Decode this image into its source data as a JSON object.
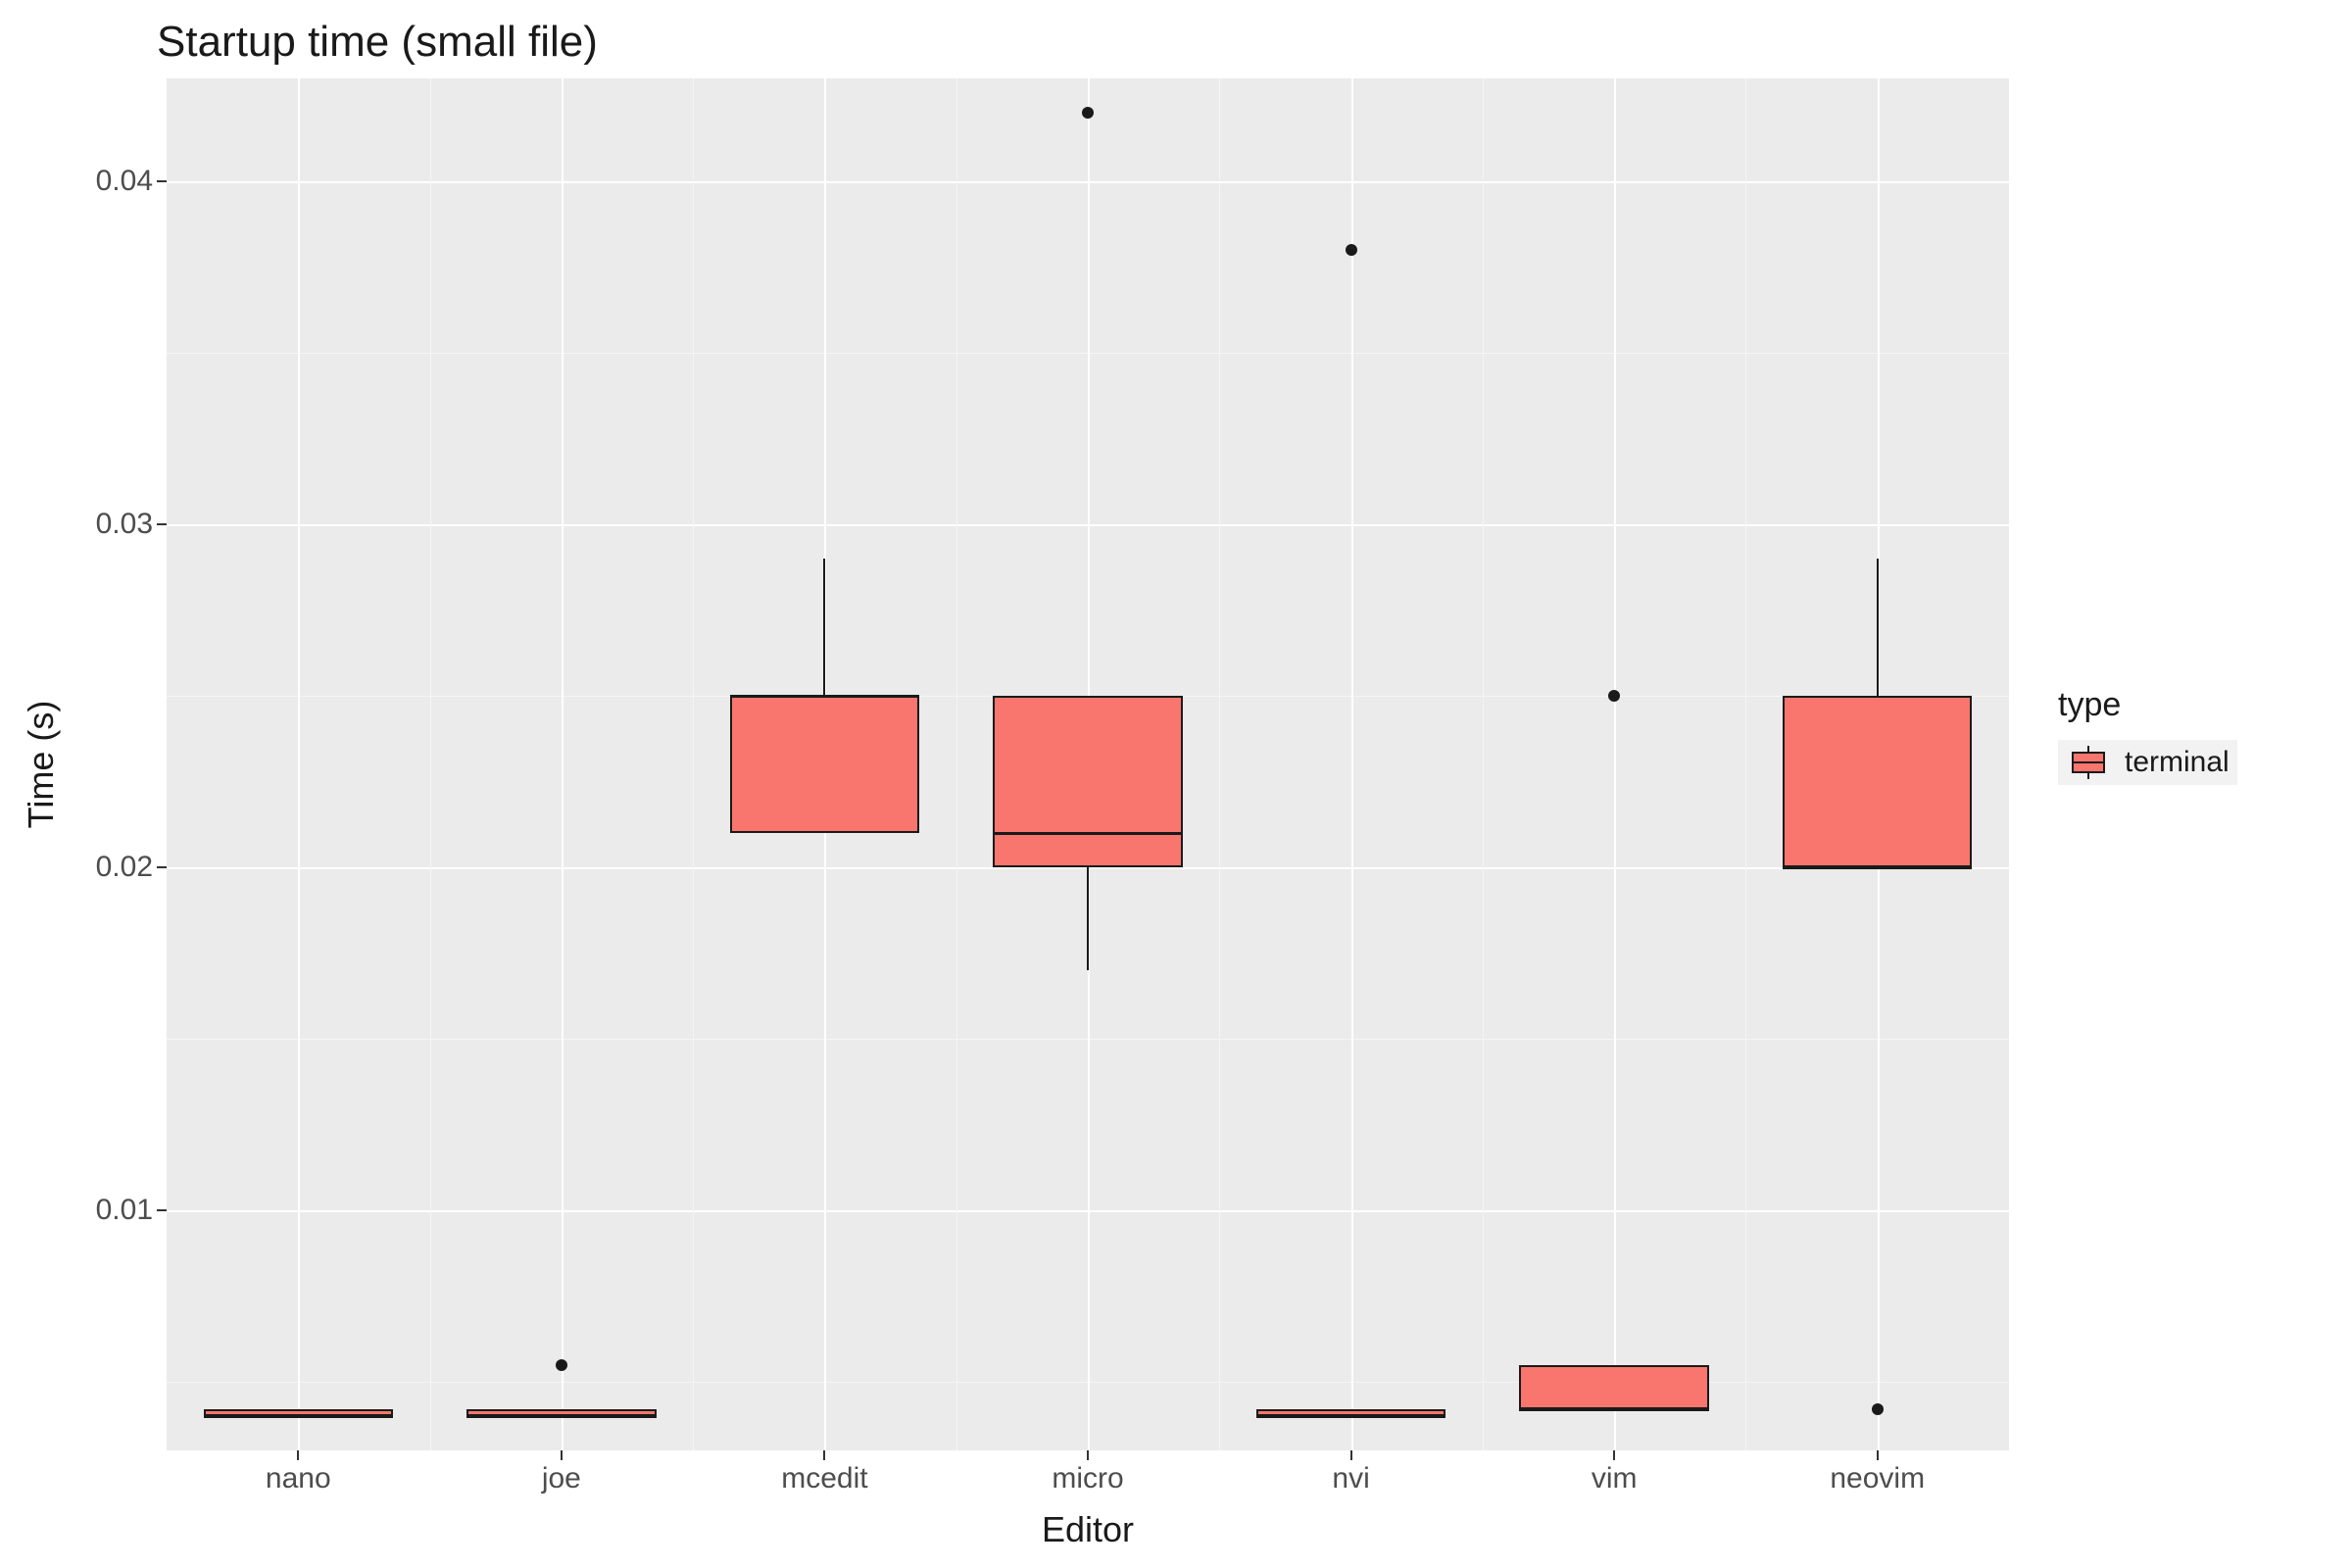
{
  "chart_data": {
    "type": "boxplot",
    "title": "Startup time (small file)",
    "xlabel": "Editor",
    "ylabel": "Time (s)",
    "ylim": [
      0.003,
      0.043
    ],
    "y_ticks": [
      0.01,
      0.02,
      0.03,
      0.04
    ],
    "y_tick_labels": [
      "0.01",
      "0.02",
      "0.03",
      "0.04"
    ],
    "categories": [
      "nano",
      "joe",
      "mcedit",
      "micro",
      "nvi",
      "vim",
      "neovim"
    ],
    "legend": {
      "title": "type",
      "entries": [
        "terminal"
      ]
    },
    "series_color": "#f8766d",
    "boxes": [
      {
        "category": "nano",
        "q1": 0.004,
        "median": 0.004,
        "q3": 0.0042,
        "whisker_low": 0.004,
        "whisker_high": 0.0042,
        "outliers": []
      },
      {
        "category": "joe",
        "q1": 0.004,
        "median": 0.004,
        "q3": 0.0042,
        "whisker_low": 0.004,
        "whisker_high": 0.0042,
        "outliers": [
          0.0055
        ]
      },
      {
        "category": "mcedit",
        "q1": 0.021,
        "median": 0.025,
        "q3": 0.025,
        "whisker_low": 0.021,
        "whisker_high": 0.029,
        "outliers": []
      },
      {
        "category": "micro",
        "q1": 0.02,
        "median": 0.021,
        "q3": 0.025,
        "whisker_low": 0.017,
        "whisker_high": 0.025,
        "outliers": [
          0.042
        ]
      },
      {
        "category": "nvi",
        "q1": 0.004,
        "median": 0.004,
        "q3": 0.0042,
        "whisker_low": 0.004,
        "whisker_high": 0.0042,
        "outliers": [
          0.038
        ]
      },
      {
        "category": "vim",
        "q1": 0.0042,
        "median": 0.0042,
        "q3": 0.0055,
        "whisker_low": 0.0042,
        "whisker_high": 0.0055,
        "outliers": [
          0.025
        ]
      },
      {
        "category": "neovim",
        "q1": 0.02,
        "median": 0.02,
        "q3": 0.025,
        "whisker_low": 0.02,
        "whisker_high": 0.029,
        "outliers": [
          0.0042
        ]
      }
    ]
  }
}
